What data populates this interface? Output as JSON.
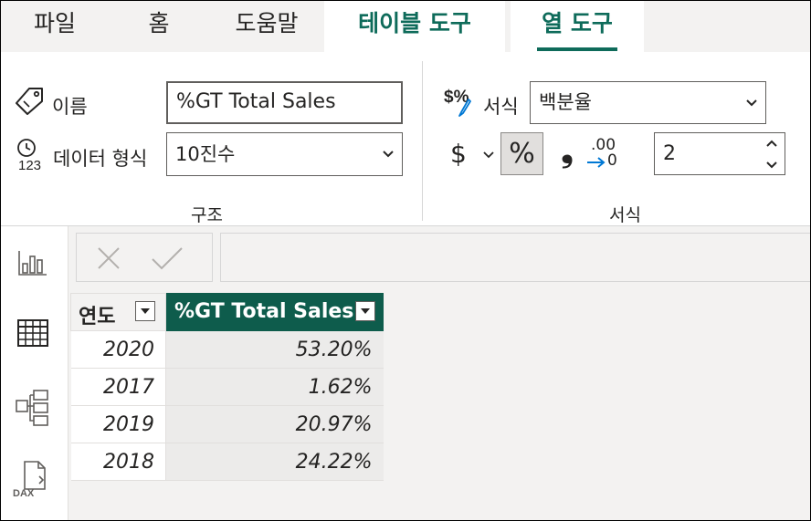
{
  "tabs": [
    {
      "label": "파일"
    },
    {
      "label": "홈"
    },
    {
      "label": "도움말"
    },
    {
      "label": "테이블 도구"
    },
    {
      "label": "열 도구"
    }
  ],
  "structure": {
    "group_label": "구조",
    "name_label": "이름",
    "name_value": "%GT Total Sales",
    "datatype_label": "데이터 형식",
    "datatype_value": "10진수"
  },
  "formatting": {
    "group_label": "서식",
    "format_label": "서식",
    "format_value": "백분율",
    "currency_symbol": "$",
    "percent_symbol": "%",
    "comma_symbol": "❟",
    "decimal_icon_top": ".00",
    "decimal_icon_bottom": "0",
    "decimal_places": "2"
  },
  "rail": {
    "icons": [
      "report-view-icon",
      "data-view-icon",
      "model-view-icon",
      "dax-query-view-icon"
    ],
    "dax_text": "DAX"
  },
  "table": {
    "columns": [
      "연도",
      "%GT Total Sales"
    ],
    "rows": [
      [
        "2020",
        "53.20%"
      ],
      [
        "2017",
        "1.62%"
      ],
      [
        "2019",
        "20.97%"
      ],
      [
        "2018",
        "24.22%"
      ]
    ]
  },
  "colors": {
    "accent": "#0e6b5a",
    "header_fill": "#0e5c4c"
  }
}
